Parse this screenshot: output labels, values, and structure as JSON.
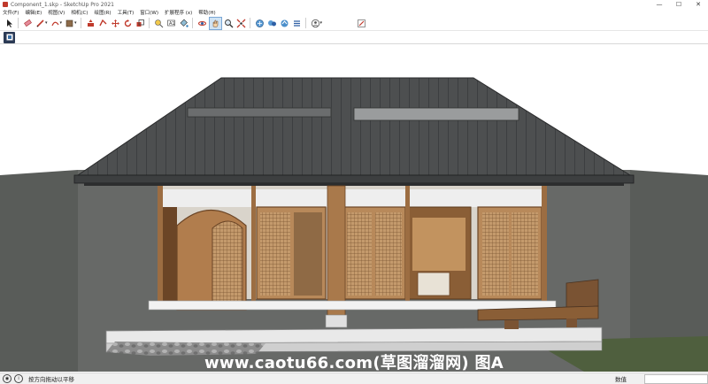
{
  "window": {
    "title": "Component_1.skp - SketchUp Pro 2021",
    "minimize": "—",
    "maximize": "☐",
    "close": "✕"
  },
  "menu": [
    "文件(F)",
    "编辑(E)",
    "视图(V)",
    "相机(C)",
    "绘图(R)",
    "工具(T)",
    "窗口(W)",
    "扩展程序 (x)",
    "帮助(H)"
  ],
  "toolbar": {
    "icons": [
      "select-icon",
      "eraser-icon",
      "pencil-icon",
      "arc-icon",
      "paint-bucket-icon",
      "push-pull-icon",
      "follow-me-icon",
      "move-icon",
      "rotate-icon",
      "scale-icon",
      "tape-measure-icon",
      "text-icon",
      "dimension-icon",
      "orbit-icon",
      "pan-icon",
      "zoom-icon",
      "zoom-extents-icon",
      "warehouse-icon",
      "extension-icon",
      "share-icon",
      "layout-icon",
      "user-icon",
      "sketch-icon"
    ]
  },
  "status": {
    "hint": "按方向拖动以平移",
    "measure_label": "数值"
  },
  "watermark": "www.caotu66.com(草图溜溜网) 图A",
  "colors": {
    "roof": "#4d4f50",
    "wood": "#a9794b",
    "wood_dark": "#6b4526",
    "platform": "#e9e9e9",
    "ground": "#595c59",
    "grass": "#4f5f3e"
  }
}
